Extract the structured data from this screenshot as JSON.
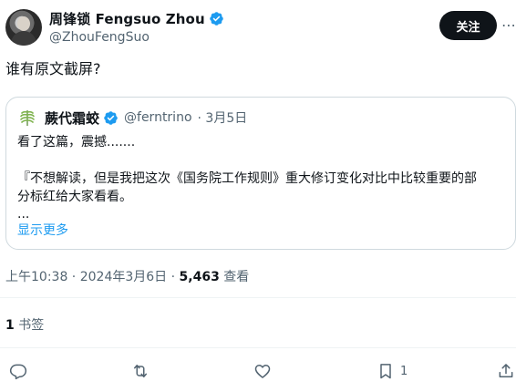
{
  "author": {
    "display_name": "周锋锁 Fengsuo Zhou",
    "handle": "@ZhouFengSuo",
    "verified": true
  },
  "follow_label": "关注",
  "more_label": "⋯",
  "tweet_text": "谁有原文截屏?",
  "quote": {
    "display_name": "蕨代霜蛟",
    "handle": "@ferntrino",
    "date": "· 3月5日",
    "verified": true,
    "lines": {
      "l1": "看了这篇，震撼.......",
      "l3": "『不想解读，但是我把这次《国务院工作规则》重大修订变化对比中比较重要的部",
      "l4": "分标红给大家看看。",
      "l5": "..."
    },
    "show_more": "显示更多"
  },
  "meta": {
    "time": "上午10:38",
    "sep": " · ",
    "date": "2024年3月6日",
    "sep2": " · ",
    "views": "5,463",
    "views_label": " 查看"
  },
  "bookmarks": {
    "count": "1",
    "label": " 书签"
  },
  "actions": {
    "reply_count": "",
    "retweet_count": "",
    "like_count": "",
    "bookmark_count": "1"
  },
  "colors": {
    "verified": "#1d9bf0",
    "link": "#1d9bf0",
    "muted": "#536471",
    "text": "#0f1419"
  }
}
